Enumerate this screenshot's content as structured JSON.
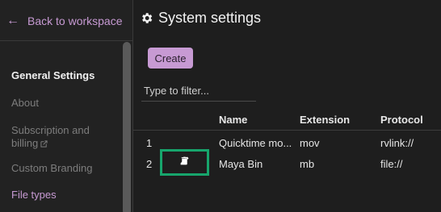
{
  "sidebar": {
    "back_label": "Back to workspace",
    "heading": "General Settings",
    "items": [
      {
        "label": "About"
      },
      {
        "label": "Subscription and billing"
      },
      {
        "label": "Custom Branding"
      },
      {
        "label": "File types"
      }
    ]
  },
  "page": {
    "title": "System settings",
    "create_label": "Create",
    "filter_placeholder": "Type to filter..."
  },
  "table": {
    "columns": [
      "Name",
      "Extension",
      "Protocol"
    ],
    "rows": [
      {
        "num": "1",
        "name": "Quicktime mo...",
        "extension": "mov",
        "protocol": "rvlink://"
      },
      {
        "num": "2",
        "name": "Maya Bin",
        "extension": "mb",
        "protocol": "file://"
      }
    ]
  },
  "colors": {
    "accent": "#c79ad3",
    "highlight": "#17a56c",
    "background": "#1e1e1e"
  },
  "icons": {
    "back": "arrow-left-icon",
    "title": "gear-icon",
    "external": "external-link-icon",
    "edit": "pencil-icon",
    "delete": "trash-icon"
  }
}
